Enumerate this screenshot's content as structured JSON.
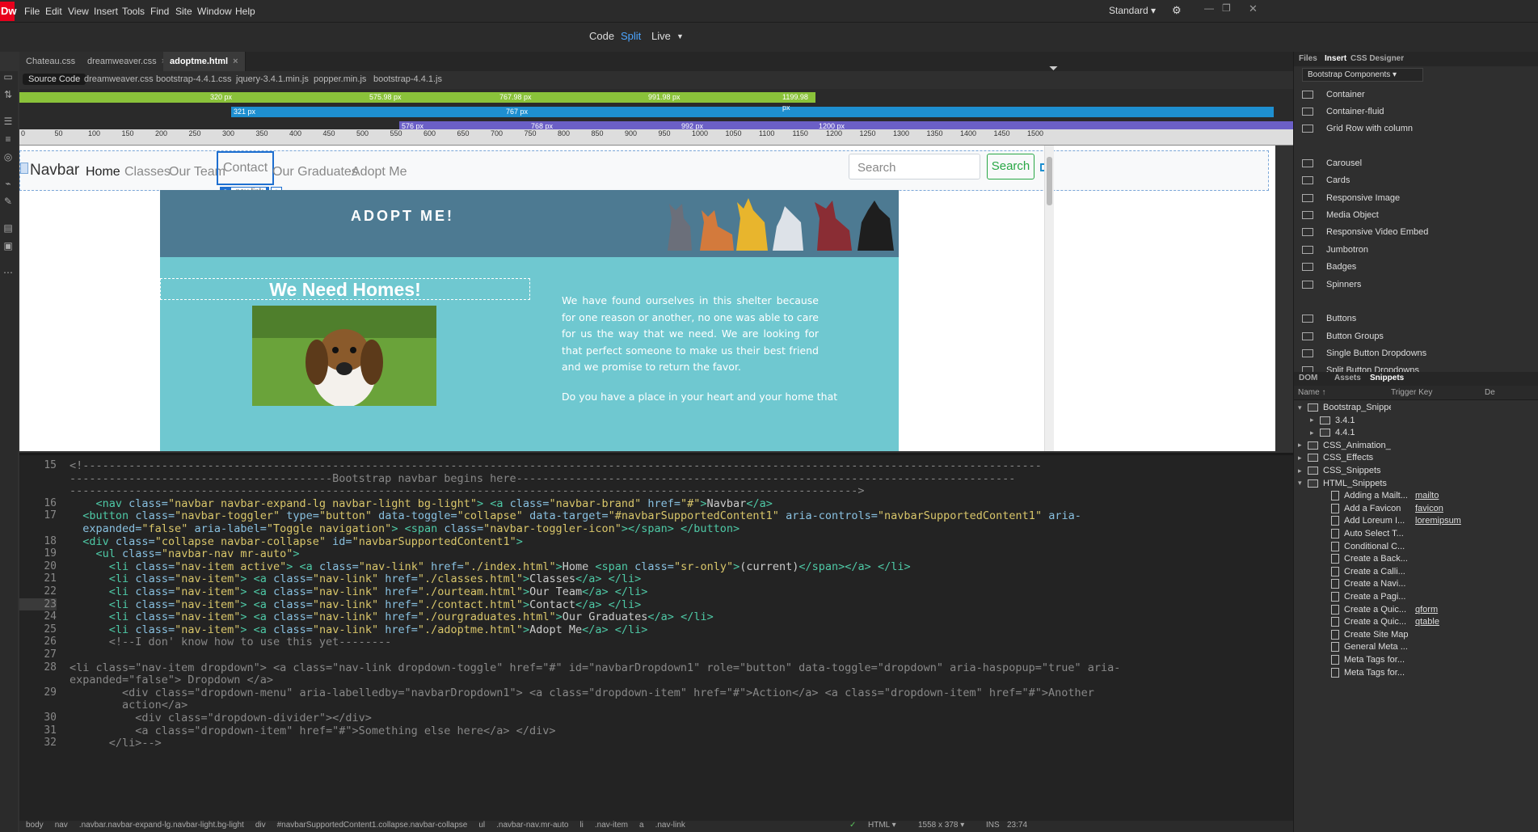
{
  "app": {
    "logo": "Dw",
    "menu": [
      "File",
      "Edit",
      "View",
      "Insert",
      "Tools",
      "Find",
      "Site",
      "Window",
      "Help"
    ],
    "workspace": "Standard"
  },
  "view": {
    "code": "Code",
    "split": "Split",
    "live": "Live"
  },
  "tabs": [
    "Chateau.css",
    "dreamweaver.css",
    "adoptme.html"
  ],
  "related_files": [
    "Source Code",
    "dreamweaver.css",
    "bootstrap-4.4.1.css",
    "jquery-3.4.1.min.js",
    "popper.min.js",
    "bootstrap-4.4.1.js"
  ],
  "media_queries": {
    "green": [
      "320 px",
      "575.98 px",
      "767.98 px",
      "991.98 px",
      "1199.98 px"
    ],
    "blue": [
      "321 px",
      "767 px"
    ],
    "purple": [
      "576 px",
      "768 px",
      "992 px",
      "1200 px"
    ]
  },
  "ruler": [
    "0",
    "50",
    "100",
    "150",
    "200",
    "250",
    "300",
    "350",
    "400",
    "450",
    "500",
    "550",
    "600",
    "650",
    "700",
    "750",
    "800",
    "850",
    "900",
    "950",
    "1000",
    "1050",
    "1100",
    "1150",
    "1200",
    "1250",
    "1300",
    "1350",
    "1400",
    "1450",
    "1500"
  ],
  "live": {
    "brand": "Navbar",
    "nav": [
      "Home",
      "Classes",
      "Our Team",
      "Contact",
      "Our Graduates",
      "Adopt Me"
    ],
    "selected_tag": "a",
    "selected_class": ".nav-link",
    "search_placeholder": "Search",
    "search_button": "Search",
    "banner_title": "ADOPT ME!",
    "section_title": "We Need Homes!",
    "paragraph1": "We have found ourselves in this shelter because for one reason or another, no one was able to care for us the way that we need. We are looking for that perfect someone to make us their best friend and we promise to return the favor.",
    "paragraph2": "Do you have a place in your heart and your home that"
  },
  "code_lines": [
    {
      "n": "15",
      "html": "<span class=\"c\">&lt;!--------------------------------------------------------------------------------------------------------------------------------------------------</span>"
    },
    {
      "n": "",
      "html": "<span class=\"c\">----------------------------------------Bootstrap navbar begins here----------------------------------------------------------------------------</span>"
    },
    {
      "n": "",
      "html": "<span class=\"c\">------------------------------------------------------------------------------------------------------------------------&gt;</span>"
    },
    {
      "n": "16",
      "html": "    <span class=\"t\">&lt;nav</span> <span class=\"a\">class=</span><span class=\"s\">\"navbar navbar-expand-lg navbar-light bg-light\"</span><span class=\"t\">&gt;</span> <span class=\"t\">&lt;a</span> <span class=\"a\">class=</span><span class=\"s\">\"navbar-brand\"</span> <span class=\"a\">href=</span><span class=\"s\">\"#\"</span><span class=\"t\">&gt;</span>Navbar<span class=\"t\">&lt;/a&gt;</span>"
    },
    {
      "n": "17",
      "html": "  <span class=\"t\">&lt;button</span> <span class=\"a\">class=</span><span class=\"s\">\"navbar-toggler\"</span> <span class=\"a\">type=</span><span class=\"s\">\"button\"</span> <span class=\"a\">data-toggle=</span><span class=\"s\">\"collapse\"</span> <span class=\"a\">data-target=</span><span class=\"s\">\"#navbarSupportedContent1\"</span> <span class=\"a\">aria-controls=</span><span class=\"s\">\"navbarSupportedContent1\"</span> <span class=\"a\">aria-</span>"
    },
    {
      "n": "",
      "html": "  <span class=\"a\">expanded=</span><span class=\"s\">\"false\"</span> <span class=\"a\">aria-label=</span><span class=\"s\">\"Toggle navigation\"</span><span class=\"t\">&gt;</span> <span class=\"t\">&lt;span</span> <span class=\"a\">class=</span><span class=\"s\">\"navbar-toggler-icon\"</span><span class=\"t\">&gt;&lt;/span&gt;</span> <span class=\"t\">&lt;/button&gt;</span>"
    },
    {
      "n": "18",
      "html": "  <span class=\"t\">&lt;div</span> <span class=\"a\">class=</span><span class=\"s\">\"collapse navbar-collapse\"</span> <span class=\"a\">id=</span><span class=\"s\">\"navbarSupportedContent1\"</span><span class=\"t\">&gt;</span>"
    },
    {
      "n": "19",
      "html": "    <span class=\"t\">&lt;ul</span> <span class=\"a\">class=</span><span class=\"s\">\"navbar-nav mr-auto\"</span><span class=\"t\">&gt;</span>"
    },
    {
      "n": "20",
      "html": "      <span class=\"t\">&lt;li</span> <span class=\"a\">class=</span><span class=\"s\">\"nav-item active\"</span><span class=\"t\">&gt;</span> <span class=\"t\">&lt;a</span> <span class=\"a\">class=</span><span class=\"s\">\"nav-link\"</span> <span class=\"a\">href=</span><span class=\"s\">\"./index.html\"</span><span class=\"t\">&gt;</span>Home <span class=\"t\">&lt;span</span> <span class=\"a\">class=</span><span class=\"s\">\"sr-only\"</span><span class=\"t\">&gt;</span>(current)<span class=\"t\">&lt;/span&gt;&lt;/a&gt;</span> <span class=\"t\">&lt;/li&gt;</span>"
    },
    {
      "n": "21",
      "html": "      <span class=\"t\">&lt;li</span> <span class=\"a\">class=</span><span class=\"s\">\"nav-item\"</span><span class=\"t\">&gt;</span> <span class=\"t\">&lt;a</span> <span class=\"a\">class=</span><span class=\"s\">\"nav-link\"</span> <span class=\"a\">href=</span><span class=\"s\">\"./classes.html\"</span><span class=\"t\">&gt;</span>Classes<span class=\"t\">&lt;/a&gt;</span> <span class=\"t\">&lt;/li&gt;</span>"
    },
    {
      "n": "22",
      "html": "      <span class=\"t\">&lt;li</span> <span class=\"a\">class=</span><span class=\"s\">\"nav-item\"</span><span class=\"t\">&gt;</span> <span class=\"t\">&lt;a</span> <span class=\"a\">class=</span><span class=\"s\">\"nav-link\"</span> <span class=\"a\">href=</span><span class=\"s\">\"./ourteam.html\"</span><span class=\"t\">&gt;</span>Our Team<span class=\"t\">&lt;/a&gt;</span> <span class=\"t\">&lt;/li&gt;</span>"
    },
    {
      "n": "23",
      "html": "      <span class=\"t\">&lt;li</span> <span class=\"a\">class=</span><span class=\"s\">\"nav-item\"</span><span class=\"t\">&gt;</span> <span class=\"t\">&lt;a</span> <span class=\"a\">class=</span><span class=\"s\">\"nav-link\"</span> <span class=\"a\">href=</span><span class=\"s\">\"./contact.html\"</span><span class=\"t\">&gt;</span>Contact<span class=\"t\">&lt;/a&gt;</span> <span class=\"t\">&lt;/li&gt;</span>"
    },
    {
      "n": "24",
      "html": "      <span class=\"t\">&lt;li</span> <span class=\"a\">class=</span><span class=\"s\">\"nav-item\"</span><span class=\"t\">&gt;</span> <span class=\"t\">&lt;a</span> <span class=\"a\">class=</span><span class=\"s\">\"nav-link\"</span> <span class=\"a\">href=</span><span class=\"s\">\"./ourgraduates.html\"</span><span class=\"t\">&gt;</span>Our Graduates<span class=\"t\">&lt;/a&gt;</span> <span class=\"t\">&lt;/li&gt;</span>"
    },
    {
      "n": "25",
      "html": "      <span class=\"t\">&lt;li</span> <span class=\"a\">class=</span><span class=\"s\">\"nav-item\"</span><span class=\"t\">&gt;</span> <span class=\"t\">&lt;a</span> <span class=\"a\">class=</span><span class=\"s\">\"nav-link\"</span> <span class=\"a\">href=</span><span class=\"s\">\"./adoptme.html\"</span><span class=\"t\">&gt;</span>Adopt Me<span class=\"t\">&lt;/a&gt;</span> <span class=\"t\">&lt;/li&gt;</span>"
    },
    {
      "n": "26",
      "html": "      <span class=\"c\">&lt;!--I don' know how to use this yet--------</span>"
    },
    {
      "n": "27",
      "html": ""
    },
    {
      "n": "28",
      "html": "<span class=\"c\">&lt;li class=\"nav-item dropdown\"&gt; &lt;a class=\"nav-link dropdown-toggle\" href=\"#\" id=\"navbarDropdown1\" role=\"button\" data-toggle=\"dropdown\" aria-haspopup=\"true\" aria-</span>"
    },
    {
      "n": "",
      "html": "<span class=\"c\">expanded=\"false\"&gt; Dropdown &lt;/a&gt;</span>"
    },
    {
      "n": "29",
      "html": "<span class=\"c\">        &lt;div class=\"dropdown-menu\" aria-labelledby=\"navbarDropdown1\"&gt; &lt;a class=\"dropdown-item\" href=\"#\"&gt;Action&lt;/a&gt; &lt;a class=\"dropdown-item\" href=\"#\"&gt;Another</span>"
    },
    {
      "n": "",
      "html": "<span class=\"c\">        action&lt;/a&gt;</span>"
    },
    {
      "n": "30",
      "html": "<span class=\"c\">          &lt;div class=\"dropdown-divider\"&gt;&lt;/div&gt;</span>"
    },
    {
      "n": "31",
      "html": "<span class=\"c\">          &lt;a class=\"dropdown-item\" href=\"#\"&gt;Something else here&lt;/a&gt; &lt;/div&gt;</span>"
    },
    {
      "n": "32",
      "html": "<span class=\"c\">      &lt;/li&gt;--&gt;</span>"
    }
  ],
  "status": {
    "tags": [
      "body",
      "nav",
      ".navbar.navbar-expand-lg.navbar-light.bg-light",
      "div",
      "#navbarSupportedContent1.collapse.navbar-collapse",
      "ul",
      ".navbar-nav.mr-auto",
      "li",
      ".nav-item",
      "a",
      ".nav-link"
    ],
    "doctype": "HTML",
    "size": "1558 x 378",
    "mode": "INS",
    "pos": "23:74"
  },
  "panel": {
    "tabs": [
      "Files",
      "Insert",
      "CSS Designer"
    ],
    "category": "Bootstrap Components",
    "components": [
      "Container",
      "Container-fluid",
      "Grid Row with column",
      "Carousel",
      "Cards",
      "Responsive Image",
      "Media Object",
      "Responsive Video Embed",
      "Jumbotron",
      "Badges",
      "Spinners",
      "Buttons",
      "Button Groups",
      "Single Button Dropdowns",
      "Split Button Dropdowns"
    ],
    "bottom_tabs": [
      "DOM",
      "Assets",
      "Snippets"
    ],
    "col_name": "Name ↑",
    "col_trigger": "Trigger Key",
    "col_desc": "De",
    "snippets": [
      {
        "name": "Bootstrap_Snippets",
        "type": "folder",
        "indent": 0,
        "open": true
      },
      {
        "name": "3.4.1",
        "type": "folder",
        "indent": 1
      },
      {
        "name": "4.4.1",
        "type": "folder",
        "indent": 1
      },
      {
        "name": "CSS_Animation_...",
        "type": "folder",
        "indent": 0
      },
      {
        "name": "CSS_Effects",
        "type": "folder",
        "indent": 0
      },
      {
        "name": "CSS_Snippets",
        "type": "folder",
        "indent": 0
      },
      {
        "name": "HTML_Snippets",
        "type": "folder",
        "indent": 0,
        "open": true
      },
      {
        "name": "Adding a Mailt...",
        "type": "file",
        "indent": 1,
        "key": "mailto"
      },
      {
        "name": "Add a Favicon",
        "type": "file",
        "indent": 1,
        "key": "favicon"
      },
      {
        "name": "Add Loreum I...",
        "type": "file",
        "indent": 1,
        "key": "loremipsum"
      },
      {
        "name": "Auto Select T...",
        "type": "file",
        "indent": 1
      },
      {
        "name": "Conditional C...",
        "type": "file",
        "indent": 1
      },
      {
        "name": "Create a Back...",
        "type": "file",
        "indent": 1
      },
      {
        "name": "Create a Calli...",
        "type": "file",
        "indent": 1
      },
      {
        "name": "Create a Navi...",
        "type": "file",
        "indent": 1
      },
      {
        "name": "Create a Pagi...",
        "type": "file",
        "indent": 1
      },
      {
        "name": "Create a Quic...",
        "type": "file",
        "indent": 1,
        "key": "qform"
      },
      {
        "name": "Create a Quic...",
        "type": "file",
        "indent": 1,
        "key": "qtable"
      },
      {
        "name": "Create Site Map",
        "type": "file",
        "indent": 1
      },
      {
        "name": "General Meta ...",
        "type": "file",
        "indent": 1
      },
      {
        "name": "Meta Tags for...",
        "type": "file",
        "indent": 1
      },
      {
        "name": "Meta Tags for...",
        "type": "file",
        "indent": 1
      }
    ]
  }
}
